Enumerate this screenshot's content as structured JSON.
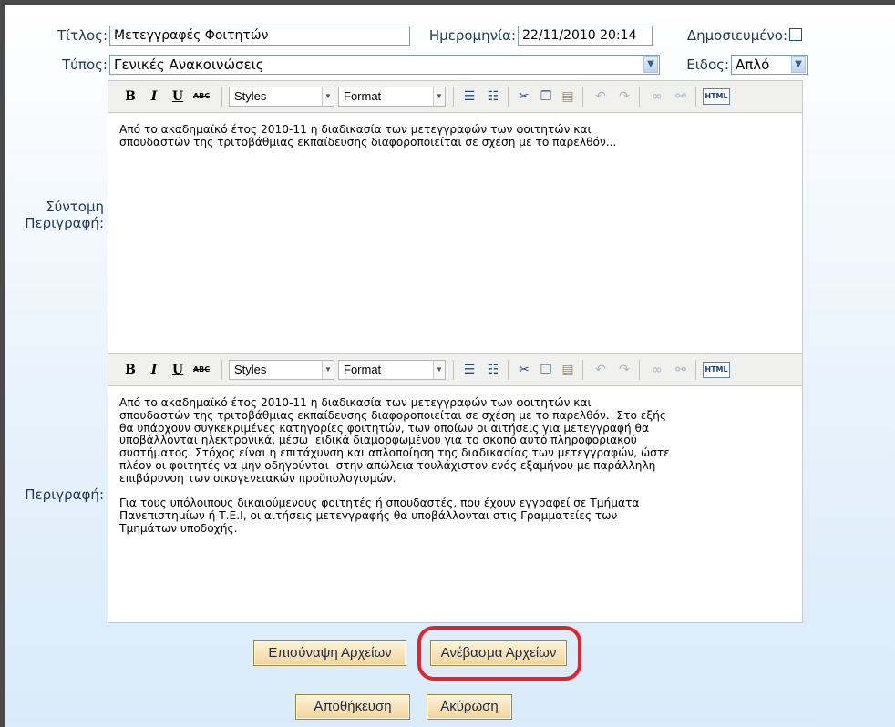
{
  "form": {
    "title_label": "Τίτλος:",
    "title_value": "Μετεγγραφές Φοιτητών",
    "date_label": "Ημερομηνία:",
    "date_value": "22/11/2010 20:14",
    "published_label": "Δημοσιευμένο:",
    "published_checked": false,
    "type_label": "Τύπος:",
    "type_value": "Γενικές Ανακοινώσεις",
    "kind_label": "Ειδος:",
    "kind_value": "Απλό",
    "short_desc_label_line1": "Σύντομη",
    "short_desc_label_line2": "Περιγραφή:",
    "desc_label": "Περιγραφή:"
  },
  "toolbar": {
    "bold": "B",
    "italic": "I",
    "underline": "U",
    "strike": "ABC",
    "styles": "Styles",
    "format": "Format",
    "html": "HTML"
  },
  "short_description": "Από το ακαδημαϊκό έτος 2010-11 η διαδικασία των μετεγγραφών των φοιτητών και\nσπουδαστών της τριτοβάθμιας εκπαίδευσης διαφοροποιείται σε σχέση με το παρελθόν...",
  "description": "Από το ακαδημαϊκό έτος 2010-11 η διαδικασία των μετεγγραφών των φοιτητών και\nσπουδαστών της τριτοβάθμιας εκπαίδευσης διαφοροποιείται σε σχέση με το παρελθόν.  Στο εξής\nθα υπάρχουν συγκεκριμένες κατηγορίες φοιτητών, των οποίων οι αιτήσεις για μετεγγραφή θα\nυποβάλλονται ηλεκτρονικά, μέσω  ειδικά διαμορφωμένου για το σκοπό αυτό πληροφοριακού\nσυστήματος. Στόχος είναι η επιτάχυνση και απλοποίηση της διαδικασίας των μετεγγραφών, ώστε\nπλέον οι φοιτητές να μην οδηγούνται  στην απώλεια τουλάχιστον ενός εξαμήνου με παράλληλη\nεπιβάρυνση των οικογενειακών προϋπολογισμών.\n\nΓια τους υπόλοιπους δικαιούμενους φοιτητές ή σπουδαστές, που έχουν εγγραφεί σε Τμήματα\nΠανεπιστημίων ή Τ.Ε.Ι, οι αιτήσεις μετεγγραφής θα υποβάλλονται στις Γραμματείες των\nΤμημάτων υποδοχής.",
  "buttons": {
    "attach": "Επισύναψη Αρχείων",
    "upload": "Ανέβασμα Αρχείων",
    "save": "Αποθήκευση",
    "cancel": "Ακύρωση"
  },
  "colors": {
    "highlight_ring": "#e0242c",
    "button_bg": "#f2d49b",
    "label": "#1f3a56"
  }
}
